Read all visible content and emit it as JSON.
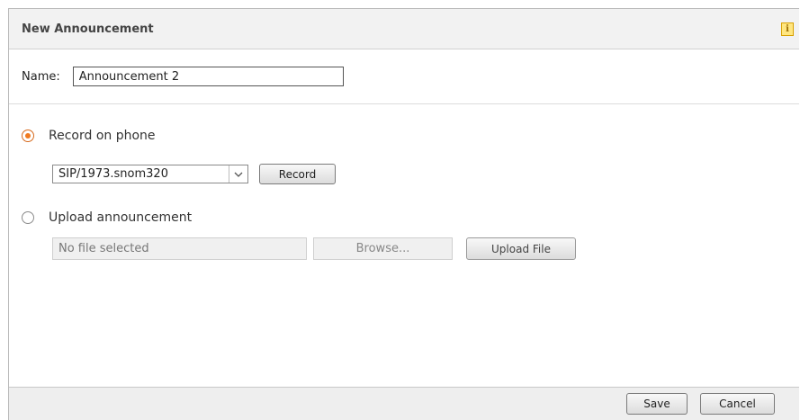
{
  "dialog": {
    "title": "New Announcement",
    "info_icon": "info-icon"
  },
  "name_field": {
    "label": "Name:",
    "value": "Announcement 2"
  },
  "record": {
    "label": "Record on phone",
    "selected": true,
    "phone_select_value": "SIP/1973.snom320",
    "record_button": "Record"
  },
  "upload": {
    "label": "Upload announcement",
    "selected": false,
    "file_placeholder": "No file selected",
    "browse_button": "Browse...",
    "upload_button": "Upload File"
  },
  "footer": {
    "save_button": "Save",
    "cancel_button": "Cancel"
  },
  "colors": {
    "accent_radio": "#f07a20",
    "titlebar_bg": "#f2f2f2"
  }
}
